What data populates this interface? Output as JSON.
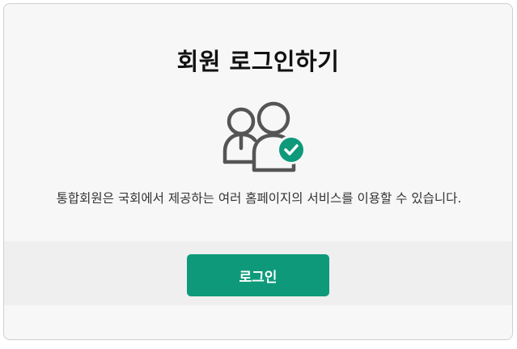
{
  "card": {
    "title": "회원 로그인하기",
    "description": "통합회원은 국회에서 제공하는 여러 홈페이지의 서비스를 이용할 수 있습니다.",
    "illustration_icon": "users-check-icon"
  },
  "actions": {
    "login_label": "로그인"
  },
  "colors": {
    "accent": "#0e9a7a",
    "card_background": "#f7f7f7",
    "action_band_background": "#efefef",
    "icon_stroke": "#555555"
  }
}
